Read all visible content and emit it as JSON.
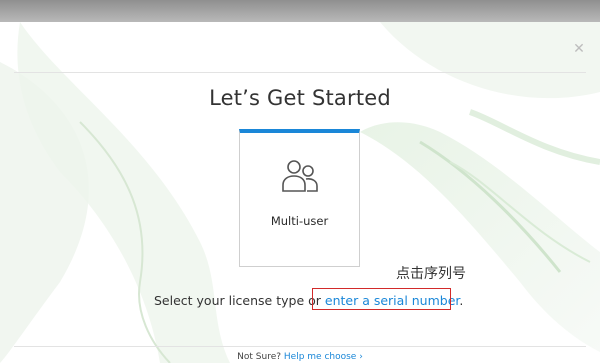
{
  "dialog": {
    "heading": "Let’s Get Started",
    "close_icon": "close-icon"
  },
  "card": {
    "label": "Multi-user",
    "icon": "users-icon",
    "accent": "#1a87d8"
  },
  "annotation": "点击序列号",
  "prompt": {
    "text": "Select your license type or ",
    "link": "enter a serial number",
    "suffix": "."
  },
  "footer": {
    "text": "Not Sure? ",
    "link": "Help me choose",
    "arrow": "›"
  }
}
